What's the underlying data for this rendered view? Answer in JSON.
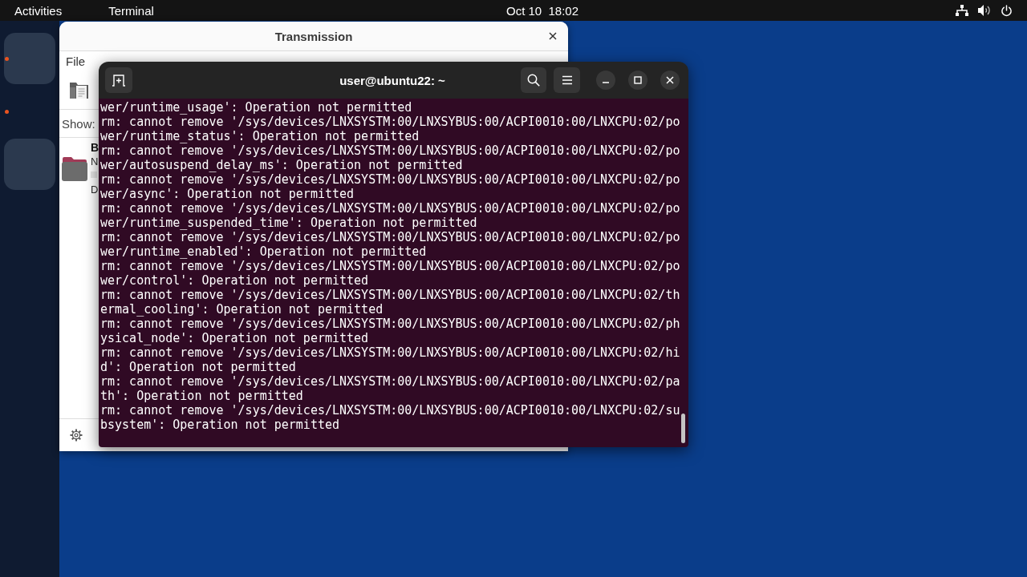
{
  "top_bar": {
    "activities": "Activities",
    "app_menu": "Terminal",
    "clock": "Oct 10  18:02"
  },
  "dock": {
    "items": [
      {
        "highlighted": true,
        "running": true
      },
      {
        "highlighted": false,
        "running": true
      },
      {
        "highlighted": true,
        "running": false
      }
    ]
  },
  "transmission": {
    "title": "Transmission",
    "menu": [
      "File"
    ],
    "filter_label": "Show:",
    "torrent": {
      "name": "B",
      "status": "N",
      "details": "D"
    }
  },
  "terminal": {
    "title": "user@ubuntu22: ~",
    "lines": [
      "wer/runtime_usage': Operation not permitted",
      "rm: cannot remove '/sys/devices/LNXSYSTM:00/LNXSYBUS:00/ACPI0010:00/LNXCPU:02/po",
      "wer/runtime_status': Operation not permitted",
      "rm: cannot remove '/sys/devices/LNXSYSTM:00/LNXSYBUS:00/ACPI0010:00/LNXCPU:02/po",
      "wer/autosuspend_delay_ms': Operation not permitted",
      "rm: cannot remove '/sys/devices/LNXSYSTM:00/LNXSYBUS:00/ACPI0010:00/LNXCPU:02/po",
      "wer/async': Operation not permitted",
      "rm: cannot remove '/sys/devices/LNXSYSTM:00/LNXSYBUS:00/ACPI0010:00/LNXCPU:02/po",
      "wer/runtime_suspended_time': Operation not permitted",
      "rm: cannot remove '/sys/devices/LNXSYSTM:00/LNXSYBUS:00/ACPI0010:00/LNXCPU:02/po",
      "wer/runtime_enabled': Operation not permitted",
      "rm: cannot remove '/sys/devices/LNXSYSTM:00/LNXSYBUS:00/ACPI0010:00/LNXCPU:02/po",
      "wer/control': Operation not permitted",
      "rm: cannot remove '/sys/devices/LNXSYSTM:00/LNXSYBUS:00/ACPI0010:00/LNXCPU:02/th",
      "ermal_cooling': Operation not permitted",
      "rm: cannot remove '/sys/devices/LNXSYSTM:00/LNXSYBUS:00/ACPI0010:00/LNXCPU:02/ph",
      "ysical_node': Operation not permitted",
      "rm: cannot remove '/sys/devices/LNXSYSTM:00/LNXSYBUS:00/ACPI0010:00/LNXCPU:02/hi",
      "d': Operation not permitted",
      "rm: cannot remove '/sys/devices/LNXSYSTM:00/LNXSYBUS:00/ACPI0010:00/LNXCPU:02/pa",
      "th': Operation not permitted",
      "rm: cannot remove '/sys/devices/LNXSYSTM:00/LNXSYBUS:00/ACPI0010:00/LNXCPU:02/su",
      "bsystem': Operation not permitted"
    ]
  }
}
